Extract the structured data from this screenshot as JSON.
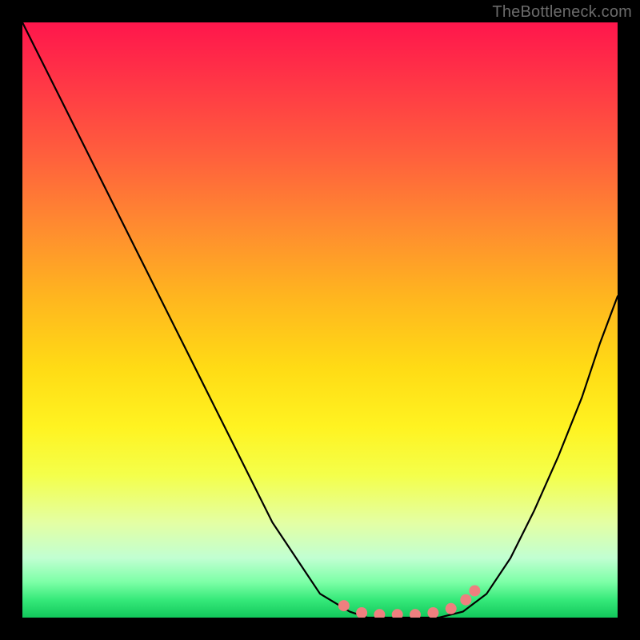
{
  "watermark": {
    "text": "TheBottleneck.com"
  },
  "colors": {
    "curve": "#000000",
    "marker": "#ef7f7f",
    "background_top": "#ff164c",
    "background_bottom": "#12c85b"
  },
  "chart_data": {
    "type": "line",
    "title": "",
    "xlabel": "",
    "ylabel": "",
    "xlim": [
      0,
      1
    ],
    "ylim": [
      0,
      100
    ],
    "grid": false,
    "legend": false,
    "series": [
      {
        "name": "bottleneck-curve",
        "x": [
          0.0,
          0.03,
          0.07,
          0.13,
          0.2,
          0.27,
          0.35,
          0.42,
          0.5,
          0.55,
          0.58,
          0.62,
          0.66,
          0.7,
          0.74,
          0.78,
          0.82,
          0.86,
          0.9,
          0.94,
          0.97,
          1.0
        ],
        "y": [
          100,
          94,
          86,
          74,
          60,
          46,
          30,
          16,
          4,
          1,
          0,
          0,
          0,
          0,
          1,
          4,
          10,
          18,
          27,
          37,
          46,
          54
        ]
      },
      {
        "name": "optimal-range-markers",
        "x": [
          0.54,
          0.57,
          0.6,
          0.63,
          0.66,
          0.69,
          0.72,
          0.745,
          0.76
        ],
        "y": [
          2.0,
          0.8,
          0.5,
          0.5,
          0.5,
          0.8,
          1.5,
          3.0,
          4.5
        ]
      }
    ],
    "annotations": []
  }
}
